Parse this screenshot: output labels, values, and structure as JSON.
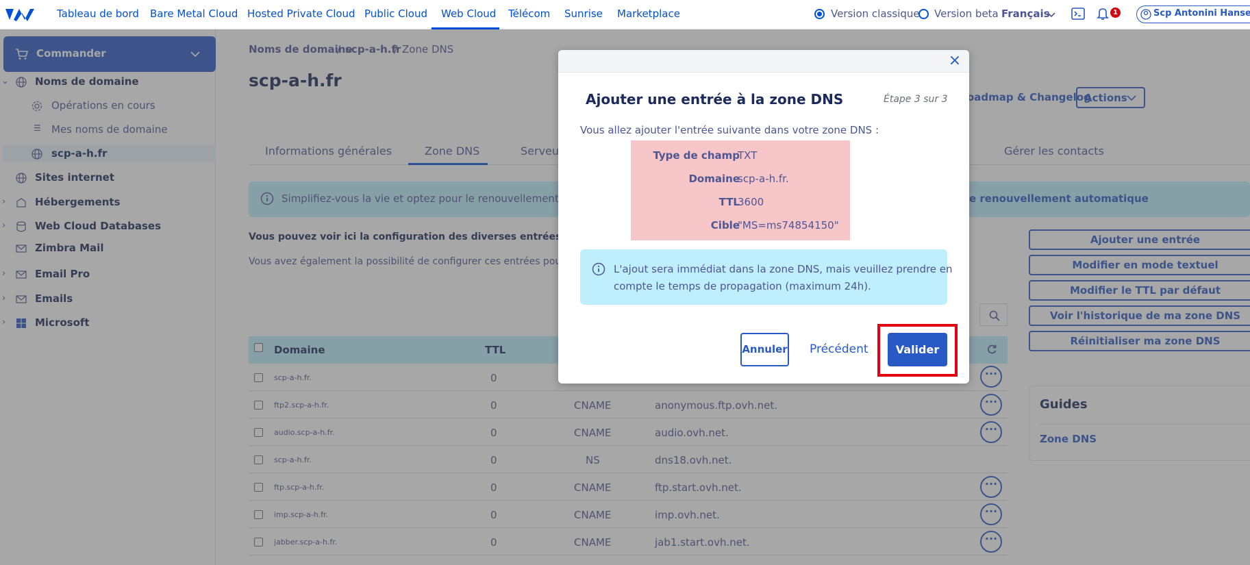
{
  "topnav": {
    "items": [
      "Tableau de bord",
      "Bare Metal Cloud",
      "Hosted Private Cloud",
      "Public Cloud",
      "Web Cloud",
      "Télécom",
      "Sunrise",
      "Marketplace"
    ],
    "active": "Web Cloud",
    "version_classic": "Version classique",
    "version_beta": "Version beta",
    "language": "Français",
    "notification_count": "1",
    "account": "Scp Antonini Hanser et"
  },
  "sidebar": {
    "order_label": "Commander",
    "items": [
      {
        "label": "Noms de domaine"
      },
      {
        "label": "Opérations en cours"
      },
      {
        "label": "Mes noms de domaine"
      },
      {
        "label": "scp-a-h.fr"
      },
      {
        "label": "Sites internet"
      },
      {
        "label": "Hébergements"
      },
      {
        "label": "Web Cloud Databases"
      },
      {
        "label": "Zimbra Mail"
      },
      {
        "label": "Email Pro"
      },
      {
        "label": "Emails"
      },
      {
        "label": "Microsoft"
      }
    ]
  },
  "main": {
    "breadcrumb": [
      "Noms de domaine",
      "/",
      "scp-a-h.fr",
      "/",
      "Zone DNS"
    ],
    "title": "scp-a-h.fr",
    "roadmap": "oadmap & Changelog",
    "actions": "Actions",
    "tabs": [
      "Informations générales",
      "Zone DNS",
      "Serveur",
      "Gérer les contacts"
    ],
    "banner_left": "Simplifiez-vous la vie et optez pour le renouvellement autom",
    "banner_right": "e renouvellement automatique",
    "desc1": "Vous pouvez voir ici la configuration des diverses entrées de vot",
    "desc2": "Vous avez également la possibilité de configurer ces entrées pour re",
    "right_buttons": [
      "Ajouter une entrée",
      "Modifier en mode textuel",
      "Modifier le TTL par défaut",
      "Voir l'historique de ma zone DNS",
      "Réinitialiser ma zone DNS"
    ],
    "guides_title": "Guides",
    "guides_item": "Zone DNS",
    "table": {
      "headers": [
        "Domaine",
        "TTL"
      ],
      "rows": [
        {
          "domain": "scp-a-h.fr.",
          "ttl": "0",
          "type": "",
          "target": ""
        },
        {
          "domain": "ftp2.scp-a-h.fr.",
          "ttl": "0",
          "type": "CNAME",
          "target": "anonymous.ftp.ovh.net."
        },
        {
          "domain": "audio.scp-a-h.fr.",
          "ttl": "0",
          "type": "CNAME",
          "target": "audio.ovh.net."
        },
        {
          "domain": "scp-a-h.fr.",
          "ttl": "0",
          "type": "NS",
          "target": "dns18.ovh.net."
        },
        {
          "domain": "ftp.scp-a-h.fr.",
          "ttl": "0",
          "type": "CNAME",
          "target": "ftp.start.ovh.net."
        },
        {
          "domain": "imp.scp-a-h.fr.",
          "ttl": "0",
          "type": "CNAME",
          "target": "imp.ovh.net."
        },
        {
          "domain": "jabber.scp-a-h.fr.",
          "ttl": "0",
          "type": "CNAME",
          "target": "jab1.start.ovh.net."
        }
      ]
    }
  },
  "modal": {
    "title": "Ajouter une entrée à la zone DNS",
    "step": "Étape 3 sur 3",
    "intro": "Vous allez ajouter l'entrée suivante dans votre zone DNS :",
    "entry": [
      {
        "label": "Type de champ",
        "value": "TXT"
      },
      {
        "label": "Domaine",
        "value": "scp-a-h.fr."
      },
      {
        "label": "TTL",
        "value": "3600"
      },
      {
        "label": "Cible",
        "value": "\"MS=ms74854150\""
      }
    ],
    "info_line1": "L'ajout sera immédiat dans la zone DNS, mais veuillez prendre en",
    "info_line2": "compte le temps de propagation (maximum 24h).",
    "cancel": "Annuler",
    "previous": "Précédent",
    "validate": "Valider",
    "colors": {
      "primary": "#2859c5",
      "highlight": "#e5000f",
      "entry_bg": "#f6c6c9",
      "info_bg": "#bfeefd"
    }
  }
}
